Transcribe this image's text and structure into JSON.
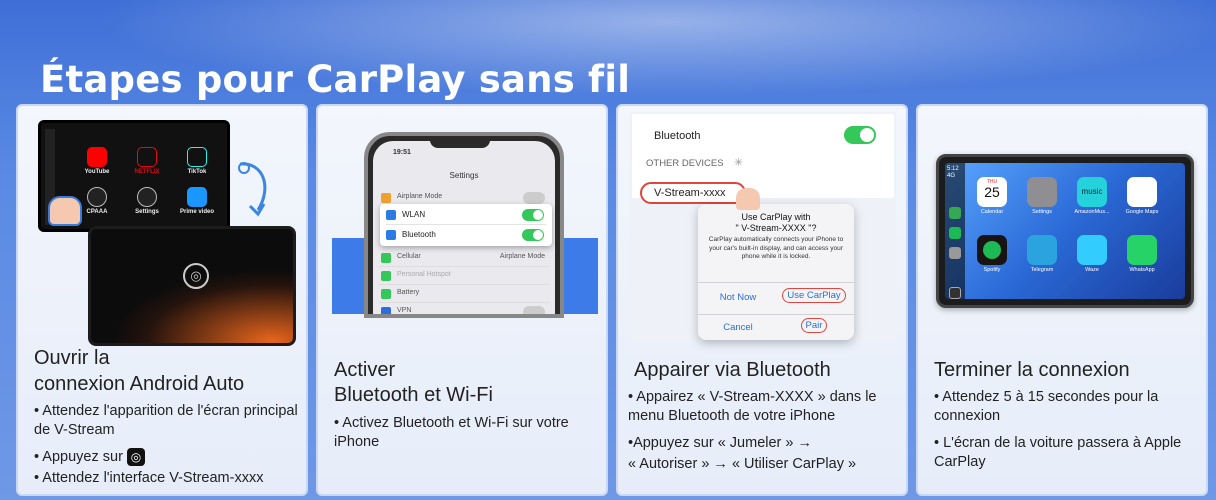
{
  "title": "Étapes pour CarPlay sans fil",
  "colors": {
    "background": "#4f7fdd",
    "card_bg": "#eef2fa",
    "accent_red": "#e0453b",
    "ios_green": "#34c759",
    "ios_blue": "#2a6fd8"
  },
  "cards": [
    {
      "title_line1": "Ouvrir la",
      "title_line2": "connexion Android Auto",
      "bullets": [
        "• Attendez l'apparition de l'écran principal de V-Stream",
        "• Appuyez sur",
        "• Attendez l'interface V-Stream-xxxx"
      ],
      "device": {
        "apps": [
          "YouTube",
          "NETFLIX",
          "TikTok",
          "CPAAA",
          "Settings",
          "Prime video"
        ]
      }
    },
    {
      "title_line1": "Activer",
      "title_line2": "Bluetooth et Wi-Fi",
      "bullets": [
        "• Activez Bluetooth et Wi-Fi sur votre iPhone"
      ],
      "phone": {
        "time": "19:51",
        "header": "Settings",
        "rows": [
          "Airplane Mode",
          "WLAN",
          "Bluetooth",
          "Cellular",
          "Personal Hotspot",
          "Battery",
          "VPN"
        ],
        "cellular_value": "Airplane Mode"
      }
    },
    {
      "title_line1": "Appairer via Bluetooth",
      "bullets": [
        "• Appairez « V-Stream-XXXX » dans le menu Bluetooth de votre iPhone",
        "•Appuyez sur « Jumeler » →",
        "« Autoriser » → « Utiliser CarPlay »"
      ],
      "bluetooth": {
        "label": "Bluetooth",
        "other_devices": "OTHER DEVICES",
        "device_name": "V-Stream-xxxx",
        "dialog_title_1": "Use CarPlay with",
        "dialog_title_2": "\" V-Stream-XXXX \"?",
        "dialog_body": "CarPlay automatically connects your iPhone to your car's built-in display, and can access your phone while it is locked.",
        "not_now": "Not Now",
        "use_carplay": "Use CarPlay",
        "cancel": "Cancel",
        "pair": "Pair"
      }
    },
    {
      "title_line1": "Terminer la connexion",
      "bullets": [
        "• Attendez 5 à 15 secondes pour la connexion",
        "• L'écran de la voiture passera à Apple CarPlay"
      ],
      "carplay": {
        "time": "5:12",
        "signal": "4G",
        "apps": [
          {
            "label": "Calendar",
            "icon": "calendar-icon",
            "text": "25",
            "day": "THU"
          },
          {
            "label": "Settings",
            "icon": "settings-icon"
          },
          {
            "label": "AmazonMus...",
            "icon": "amazon-music-icon",
            "text": "music"
          },
          {
            "label": "Google Maps",
            "icon": "google-maps-icon"
          },
          {
            "label": "Spotify",
            "icon": "spotify-icon"
          },
          {
            "label": "Telegram",
            "icon": "telegram-icon"
          },
          {
            "label": "Waze",
            "icon": "waze-icon"
          },
          {
            "label": "WhatsApp",
            "icon": "whatsapp-icon"
          }
        ]
      }
    }
  ]
}
